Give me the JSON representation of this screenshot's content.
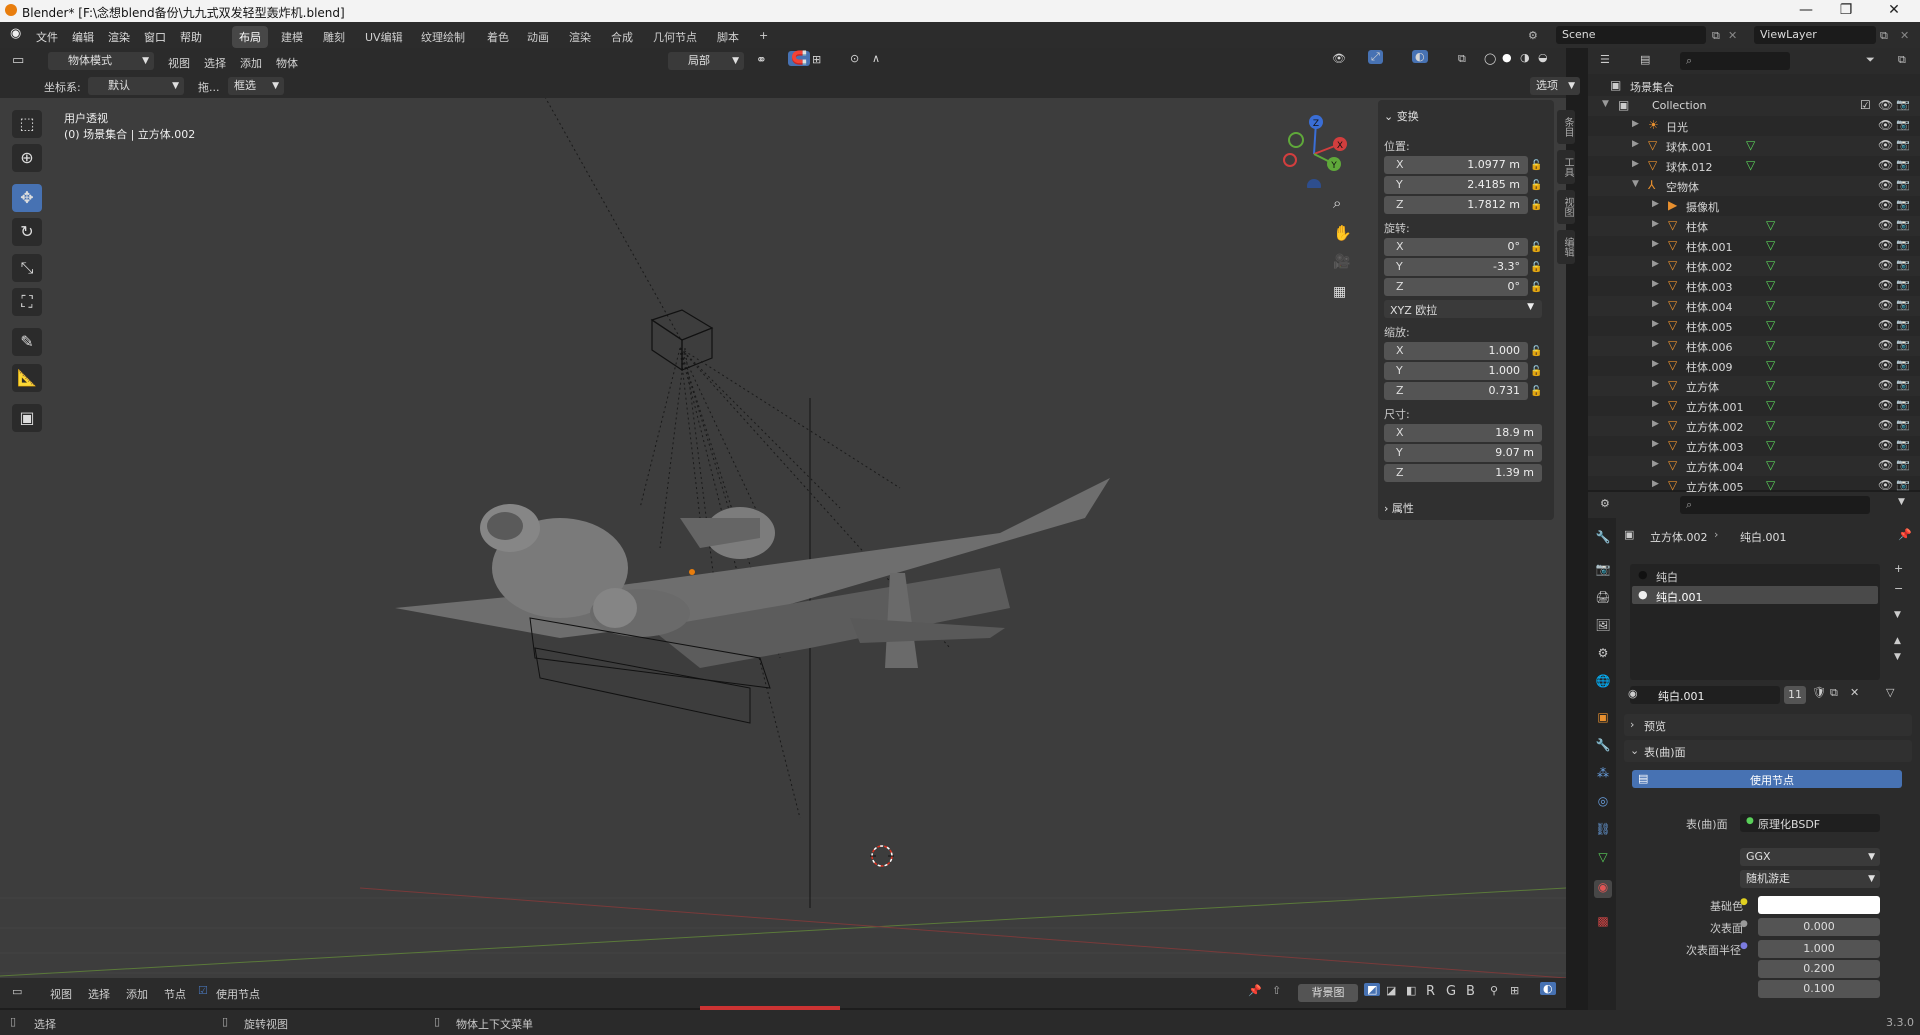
{
  "window": {
    "title": "Blender* [F:\\念想blend备份\\九九式双发轻型轰炸机.blend]",
    "minimize": "—",
    "maximize": "❐",
    "close": "✕"
  },
  "menu": {
    "items": [
      "文件",
      "编辑",
      "渲染",
      "窗口",
      "帮助"
    ]
  },
  "workspaces": [
    "布局",
    "建模",
    "雕刻",
    "UV编辑",
    "纹理绘制",
    "着色",
    "动画",
    "渲染",
    "合成",
    "几何节点",
    "脚本",
    "+"
  ],
  "scene": {
    "name": "Scene",
    "view_layer": "ViewLayer"
  },
  "viewport": {
    "mode": "物体模式",
    "header_menus": [
      "视图",
      "选择",
      "添加",
      "物体"
    ],
    "transform_orientation": "局部",
    "coord_label": "坐标系:",
    "coord_value": "默认",
    "drag_label": "拖...",
    "drag_value": "框选",
    "options": "选项",
    "view_name": "用户透视",
    "view_object": "(0) 场景集合 | 立方体.002"
  },
  "npanel": {
    "transform_title": "变换",
    "location_label": "位置:",
    "location": [
      {
        "axis": "X",
        "value": "1.0977 m"
      },
      {
        "axis": "Y",
        "value": "2.4185 m"
      },
      {
        "axis": "Z",
        "value": "1.7812 m"
      }
    ],
    "rotation_label": "旋转:",
    "rotation": [
      {
        "axis": "X",
        "value": "0°"
      },
      {
        "axis": "Y",
        "value": "-3.3°"
      },
      {
        "axis": "Z",
        "value": "0°"
      }
    ],
    "rotation_mode": "XYZ 欧拉",
    "scale_label": "缩放:",
    "scale": [
      {
        "axis": "X",
        "value": "1.000"
      },
      {
        "axis": "Y",
        "value": "1.000"
      },
      {
        "axis": "Z",
        "value": "0.731"
      }
    ],
    "dimensions_label": "尺寸:",
    "dimensions": [
      {
        "axis": "X",
        "value": "18.9 m"
      },
      {
        "axis": "Y",
        "value": "9.07 m"
      },
      {
        "axis": "Z",
        "value": "1.39 m"
      }
    ],
    "properties_title": "属性",
    "side_tabs": [
      "条目",
      "工具",
      "视图",
      "编辑"
    ]
  },
  "gizmo": {
    "x": "X",
    "y": "Y",
    "z": "Z"
  },
  "outliner": {
    "root": "场景集合",
    "collection": "Collection",
    "items": [
      {
        "label": "日光",
        "indent": 2,
        "icon": "light"
      },
      {
        "label": "球体.001",
        "indent": 2,
        "icon": "mesh"
      },
      {
        "label": "球体.012",
        "indent": 2,
        "icon": "mesh"
      },
      {
        "label": "空物体",
        "indent": 2,
        "icon": "empty",
        "expanded": true
      },
      {
        "label": "摄像机",
        "indent": 3,
        "icon": "camera"
      },
      {
        "label": "柱体",
        "indent": 3,
        "icon": "mesh"
      },
      {
        "label": "柱体.001",
        "indent": 3,
        "icon": "mesh"
      },
      {
        "label": "柱体.002",
        "indent": 3,
        "icon": "mesh"
      },
      {
        "label": "柱体.003",
        "indent": 3,
        "icon": "mesh"
      },
      {
        "label": "柱体.004",
        "indent": 3,
        "icon": "mesh"
      },
      {
        "label": "柱体.005",
        "indent": 3,
        "icon": "mesh"
      },
      {
        "label": "柱体.006",
        "indent": 3,
        "icon": "mesh"
      },
      {
        "label": "柱体.009",
        "indent": 3,
        "icon": "mesh"
      },
      {
        "label": "立方体",
        "indent": 3,
        "icon": "mesh"
      },
      {
        "label": "立方体.001",
        "indent": 3,
        "icon": "mesh"
      },
      {
        "label": "立方体.002",
        "indent": 3,
        "icon": "mesh"
      },
      {
        "label": "立方体.003",
        "indent": 3,
        "icon": "mesh"
      },
      {
        "label": "立方体.004",
        "indent": 3,
        "icon": "mesh"
      },
      {
        "label": "立方体.005",
        "indent": 3,
        "icon": "mesh"
      }
    ]
  },
  "properties": {
    "breadcrumb_object": "立方体.002",
    "breadcrumb_material": "纯白.001",
    "slots": [
      "纯白",
      "纯白.001"
    ],
    "material_name": "纯白.001",
    "users": "11",
    "preview": "预览",
    "surface_section": "表(曲)面",
    "use_nodes": "使用节点",
    "surface_label": "表(曲)面",
    "surface_value": "原理化BSDF",
    "distribution": "GGX",
    "subsurface_method": "随机游走",
    "base_color_label": "基础色",
    "subsurface_label": "次表面",
    "subsurface_value": "0.000",
    "subsurface_radius_label": "次表面半径",
    "subsurface_radius": [
      "1.000",
      "0.200",
      "0.100"
    ]
  },
  "bottom_editor": {
    "menus": [
      "视图",
      "选择",
      "添加",
      "节点"
    ],
    "use_nodes": "使用节点",
    "backdrop": "背景图",
    "channels": [
      "R",
      "G",
      "B"
    ]
  },
  "status": {
    "select": "选择",
    "rotate": "旋转视图",
    "context": "物体上下文菜单",
    "version": "3.3.0"
  },
  "colors": {
    "accent": "#4772b3",
    "orange": "#e87d0d",
    "mesh_icon": "#e8902f",
    "vertex_green": "#5ad05a"
  }
}
